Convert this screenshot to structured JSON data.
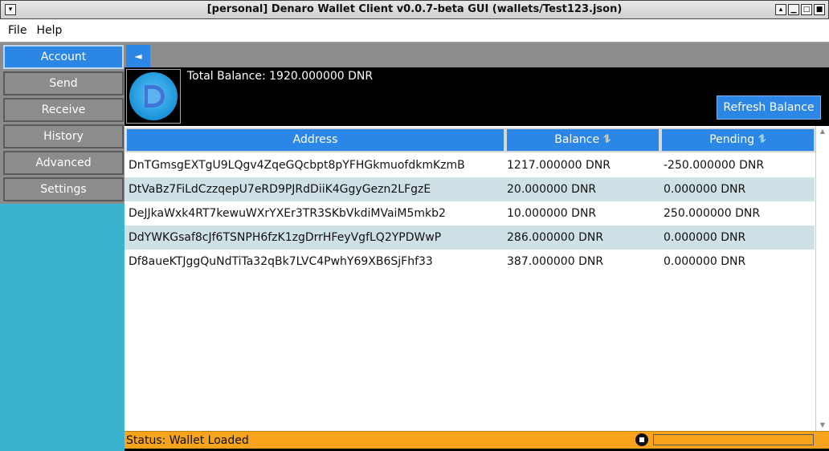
{
  "window": {
    "title": "[personal] Denaro Wallet Client v0.0.7-beta GUI (wallets/Test123.json)",
    "buttons": [
      "window-menu-icon",
      "shade-icon",
      "minimize-icon",
      "maximize-icon",
      "close-icon"
    ]
  },
  "menu": {
    "file": "File",
    "help": "Help"
  },
  "nav": {
    "account": "Account",
    "send": "Send",
    "receive": "Receive",
    "history": "History",
    "advanced": "Advanced",
    "settings": "Settings",
    "collapse_glyph": "◄"
  },
  "header": {
    "total_balance": "Total Balance: 1920.000000 DNR",
    "refresh_label": "Refresh Balance"
  },
  "table": {
    "columns": {
      "address": "Address",
      "balance": "Balance ⥮",
      "pending": "Pending ⥮"
    },
    "rows": [
      {
        "address": "DnTGmsgEXTgU9LQgv4ZqeGQcbpt8pYFHGkmuofdkmKzmB",
        "balance": "1217.000000 DNR",
        "pending": "-250.000000 DNR"
      },
      {
        "address": "DtVaBz7FiLdCzzqepU7eRD9PJRdDiiK4GgyGezn2LFgzE",
        "balance": "20.000000 DNR",
        "pending": "0.000000 DNR"
      },
      {
        "address": "DeJJkaWxk4RT7kewuWXrYXEr3TR3SKbVkdiMVaiM5mkb2",
        "balance": "10.000000 DNR",
        "pending": "250.000000 DNR"
      },
      {
        "address": "DdYWKGsaf8cJf6TSNPH6fzK1zgDrrHFeyVgfLQ2YPDWwP",
        "balance": "286.000000 DNR",
        "pending": "0.000000 DNR"
      },
      {
        "address": "Df8aueKTJggQuNdTiTa32qBk7LVC4PwhY69XB6SjFhf33",
        "balance": "387.000000 DNR",
        "pending": "0.000000 DNR"
      }
    ]
  },
  "status": {
    "text": "Status: Wallet Loaded",
    "progress": 0
  },
  "colors": {
    "accent": "#2c86e6",
    "sidebar": "#3bb3cf",
    "status_bar": "#f7a31b",
    "row_alt": "#cfe1e6"
  }
}
